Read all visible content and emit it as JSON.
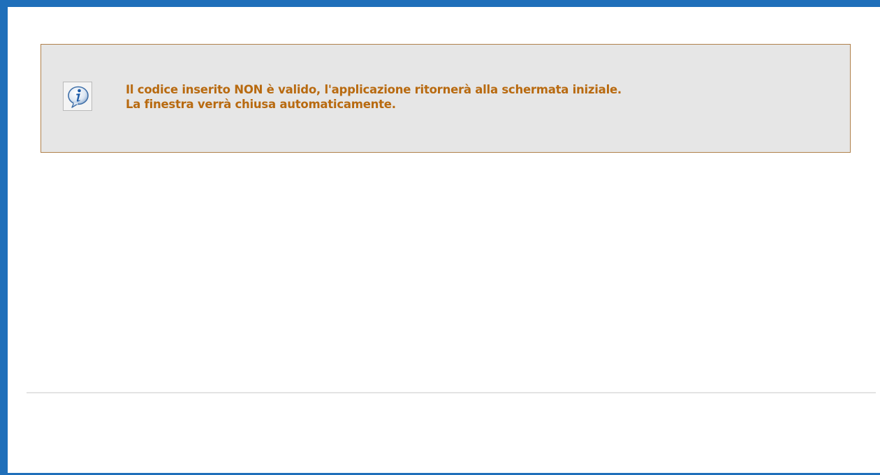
{
  "message": {
    "icon": "info-icon",
    "lines": [
      "Il codice inserito NON è valido, l'applicazione ritornerà alla schermata iniziale.",
      "La finestra verrà chiusa automaticamente."
    ]
  },
  "colors": {
    "window_border": "#1f6fba",
    "panel_border": "#b0804a",
    "panel_background": "#e6e6e6",
    "message_text": "#b86a10",
    "icon_accent": "#1a5aa8"
  }
}
